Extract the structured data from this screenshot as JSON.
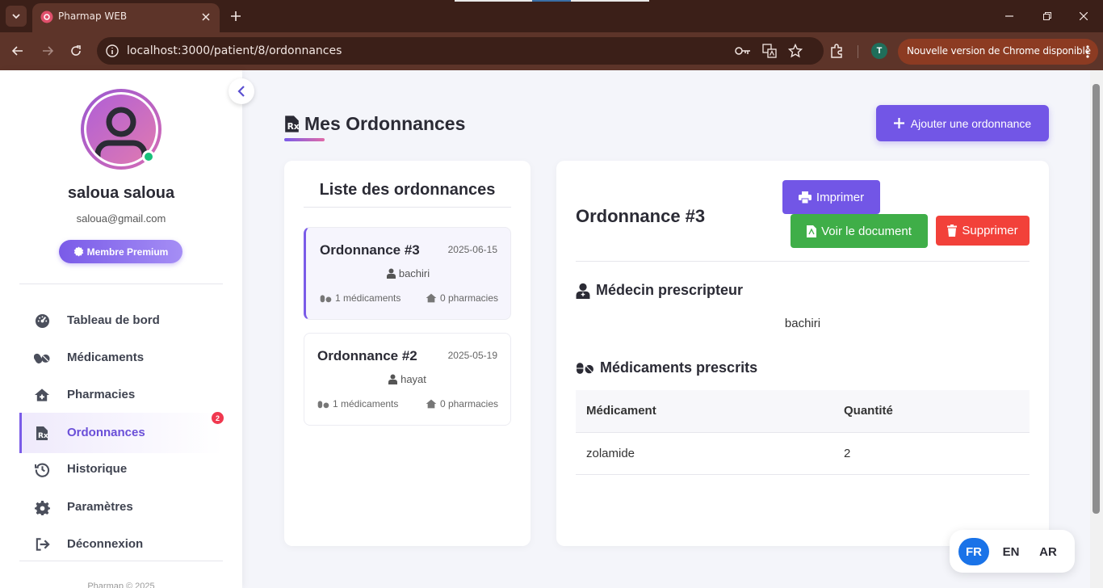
{
  "browser": {
    "tab_title": "Pharmap WEB",
    "url": "localhost:3000/patient/8/ordonnances",
    "profile_initial": "T",
    "update_label": "Nouvelle version de Chrome disponible"
  },
  "sidebar": {
    "user_name": "saloua saloua",
    "user_email": "saloua@gmail.com",
    "badge_label": "Membre Premium",
    "items": [
      {
        "label": "Tableau de bord",
        "icon": "dashboard-icon"
      },
      {
        "label": "Médicaments",
        "icon": "pills-icon"
      },
      {
        "label": "Pharmacies",
        "icon": "pharmacy-icon"
      },
      {
        "label": "Ordonnances",
        "icon": "prescription-icon",
        "active": true,
        "badge": "2"
      },
      {
        "label": "Historique",
        "icon": "history-icon"
      },
      {
        "label": "Paramètres",
        "icon": "gear-icon"
      },
      {
        "label": "Déconnexion",
        "icon": "logout-icon"
      }
    ],
    "footer": "Pharmap © 2025"
  },
  "main": {
    "title": "Mes Ordonnances",
    "add_button": "Ajouter une ordonnance",
    "list": {
      "title": "Liste des ordonnances",
      "items": [
        {
          "name": "Ordonnance #3",
          "date": "2025-06-15",
          "doctor": "bachiri",
          "meds": "1 médicaments",
          "pharmacies": "0 pharmacies"
        },
        {
          "name": "Ordonnance #2",
          "date": "2025-05-19",
          "doctor": "hayat",
          "meds": "1 médicaments",
          "pharmacies": "0 pharmacies"
        }
      ]
    },
    "detail": {
      "title": "Ordonnance #3",
      "print_button": "Imprimer",
      "view_button": "Voir le document",
      "delete_button": "Supprimer",
      "doctor_section": "Médecin prescripteur",
      "doctor_name": "bachiri",
      "meds_section": "Médicaments prescrits",
      "table_headers": [
        "Médicament",
        "Quantité"
      ],
      "table_rows": [
        [
          "zolamide",
          "2"
        ]
      ]
    }
  },
  "languages": {
    "fr": "FR",
    "en": "EN",
    "ar": "AR",
    "active": "FR"
  },
  "colors": {
    "accent": "#7256e6",
    "success": "#3fae48",
    "danger": "#f2413a",
    "chrome_bg": "#5d3429"
  }
}
